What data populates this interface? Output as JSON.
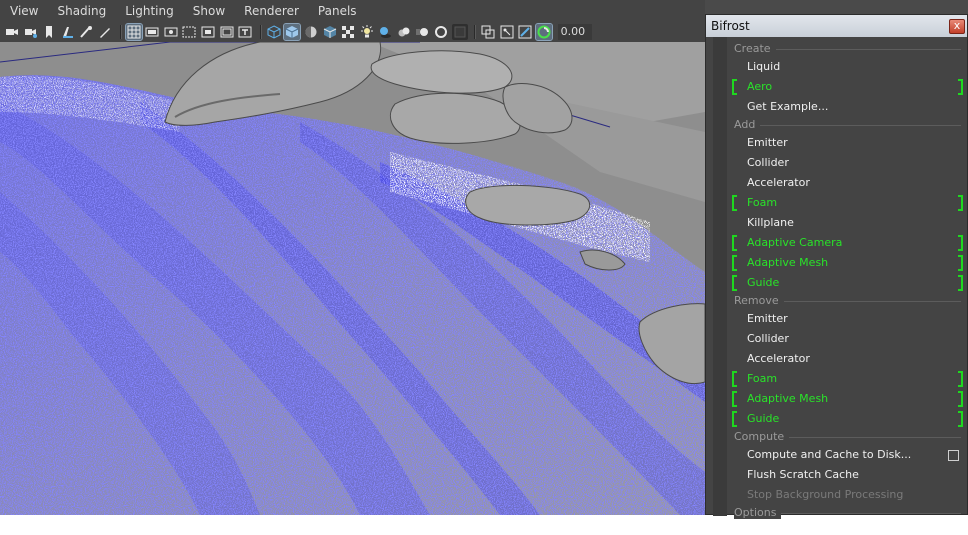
{
  "viewport": {
    "menu": [
      "View",
      "Shading",
      "Lighting",
      "Show",
      "Renderer",
      "Panels"
    ],
    "exposure_value": "0.00"
  },
  "bifrost": {
    "title": "Bifrost",
    "close_glyph": "x",
    "sections": {
      "create": "Create",
      "add": "Add",
      "remove": "Remove",
      "compute": "Compute",
      "options": "Options"
    },
    "items": {
      "liquid": "Liquid",
      "aero": "Aero",
      "get_example": "Get Example...",
      "add_emitter": "Emitter",
      "add_collider": "Collider",
      "add_accelerator": "Accelerator",
      "add_foam": "Foam",
      "add_killplane": "Killplane",
      "add_adaptive_camera": "Adaptive Camera",
      "add_adaptive_mesh": "Adaptive Mesh",
      "add_guide": "Guide",
      "rem_emitter": "Emitter",
      "rem_collider": "Collider",
      "rem_accelerator": "Accelerator",
      "rem_foam": "Foam",
      "rem_adaptive_mesh": "Adaptive Mesh",
      "rem_guide": "Guide",
      "compute_cache": "Compute and Cache to Disk...",
      "flush_cache": "Flush Scratch Cache",
      "stop_bg": "Stop Background Processing"
    }
  },
  "colors": {
    "option_green": "#29e329",
    "particle_blue": "#3a3aff"
  }
}
